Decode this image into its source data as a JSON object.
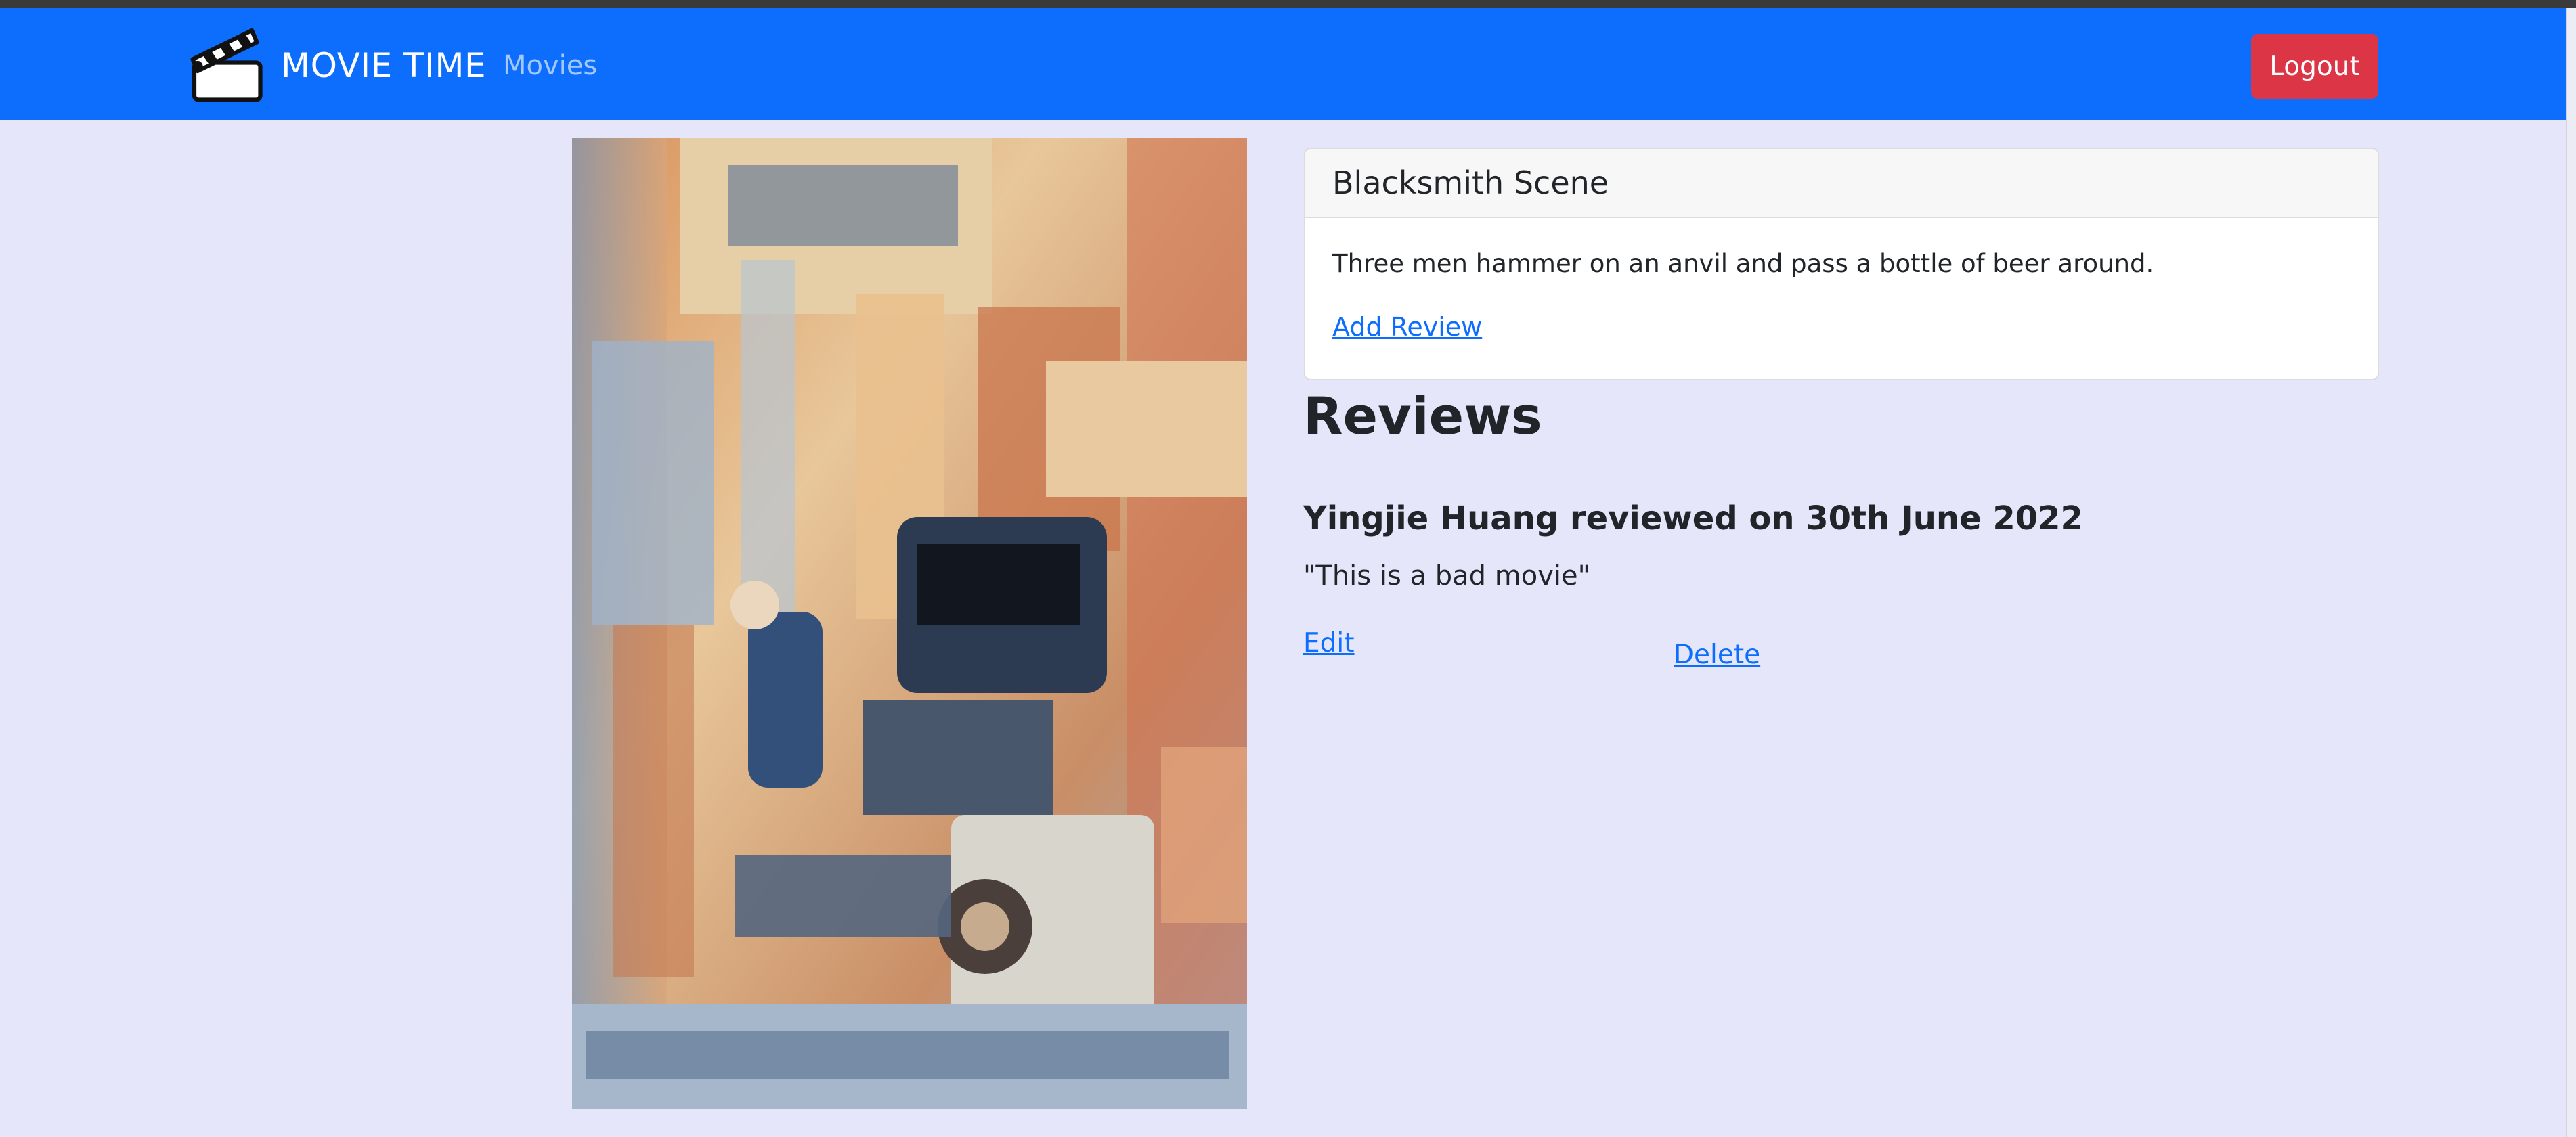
{
  "navbar": {
    "brand": "MOVIE TIME",
    "movies_link": "Movies",
    "logout_label": "Logout",
    "background_color": "#0d6efd",
    "logout_color": "#dc3545",
    "logo_icon": "clapperboard-icon"
  },
  "movie": {
    "title": "Blacksmith Scene",
    "description": "Three men hammer on an anvil and pass a bottle of beer around.",
    "add_review_label": "Add Review",
    "poster_icon": "movie-poster-image"
  },
  "reviews": {
    "heading": "Reviews",
    "items": [
      {
        "title": "Yingjie Huang reviewed on 30th June 2022",
        "text": "\"This is a bad movie\"",
        "edit_label": "Edit",
        "delete_label": "Delete"
      }
    ]
  },
  "colors": {
    "page_background": "#e6e6fa",
    "link": "#0d6efd"
  }
}
